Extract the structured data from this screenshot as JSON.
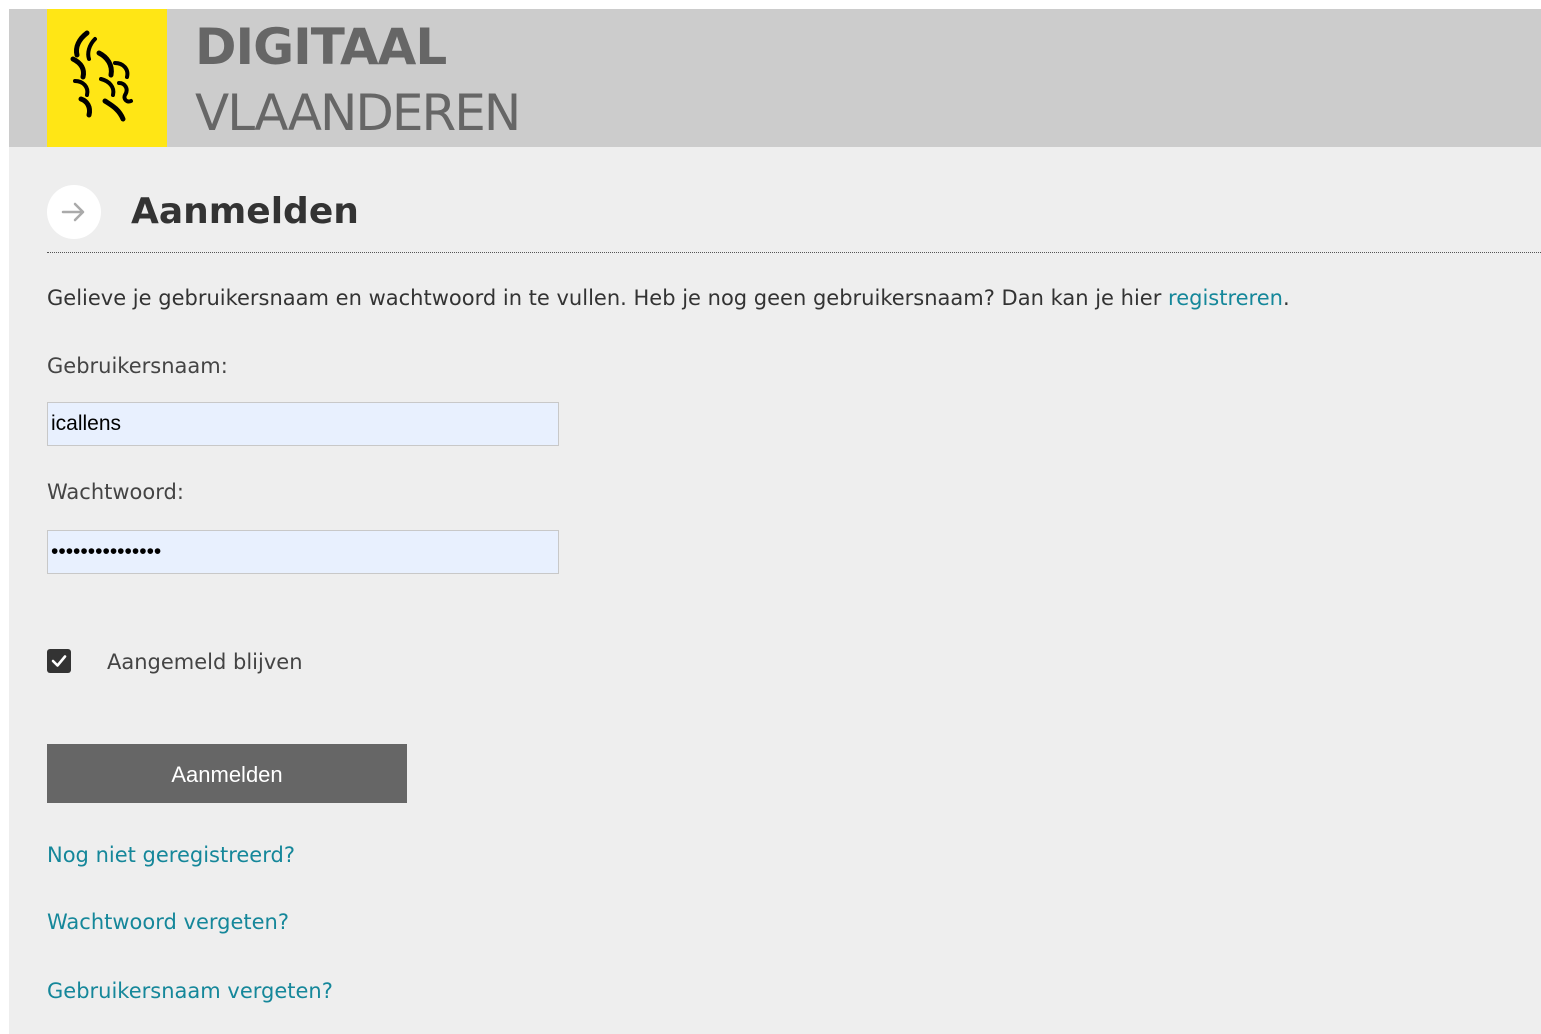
{
  "header": {
    "brand_line1": "DIGITAAL",
    "brand_line2": "VLAANDEREN",
    "logo_icon": "flemish-lion-icon",
    "logo_background": "#ffe615",
    "background": "#cccccc"
  },
  "title": {
    "icon": "arrow-right-icon",
    "text": "Aanmelden"
  },
  "intro": {
    "text": "Gelieve je gebruikersnaam en wachtwoord in te vullen. Heb je nog geen gebruikersnaam? Dan kan je hier ",
    "link_text": "registreren",
    "end": "."
  },
  "form": {
    "username_label": "Gebruikersnaam:",
    "username_value": "icallens",
    "password_label": "Wachtwoord:",
    "password_value": "icallens1234567",
    "remember_label": "Aangemeld blijven",
    "remember_checked": true,
    "submit_label": "Aanmelden"
  },
  "links": {
    "not_registered": "Nog niet geregistreerd?",
    "forgot_password": "Wachtwoord vergeten?",
    "forgot_username": "Gebruikersnaam vergeten?"
  },
  "colors": {
    "link": "#15879a",
    "button": "#666666",
    "input_background": "#e8f0fe",
    "page_background": "#eeeeee"
  }
}
